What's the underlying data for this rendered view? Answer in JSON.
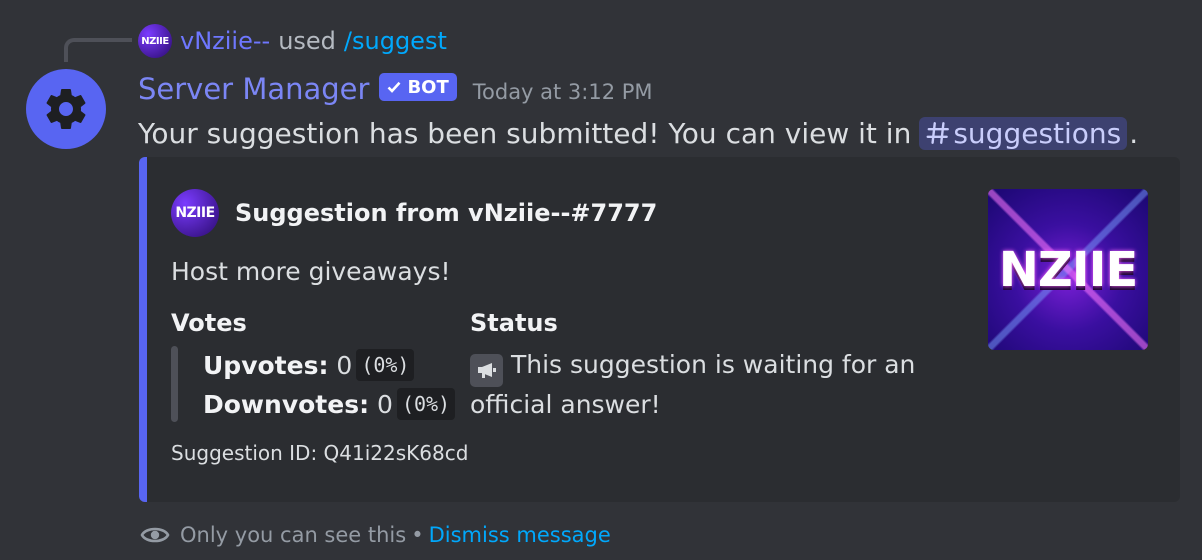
{
  "reply": {
    "avatar_text": "NZIIE",
    "username": "vNziie--",
    "used_label": "used",
    "command": "/suggest"
  },
  "message": {
    "author": "Server Manager",
    "bot_tag": "BOT",
    "timestamp": "Today at 3:12 PM",
    "text_before": "Your suggestion has been submitted! You can view it in",
    "channel": "suggestions",
    "text_after": "."
  },
  "embed": {
    "accent_color": "#5865f2",
    "author_avatar_text": "NZIIE",
    "author_name": "Suggestion from vNziie--#7777",
    "description": "Host more giveaways!",
    "votes_label": "Votes",
    "upvotes_label": "Upvotes:",
    "upvotes_count": "0",
    "upvotes_pct": "(0%)",
    "downvotes_label": "Downvotes:",
    "downvotes_count": "0",
    "downvotes_pct": "(0%)",
    "status_label": "Status",
    "status_icon": "megaphone-icon",
    "status_text": "This suggestion is waiting for an official answer!",
    "footer": "Suggestion ID: Q41i22sK68cd",
    "thumbnail_text": "NZIIE"
  },
  "ephemeral": {
    "icon": "eye-icon",
    "notice": "Only you can see this",
    "separator": "•",
    "dismiss": "Dismiss message"
  }
}
